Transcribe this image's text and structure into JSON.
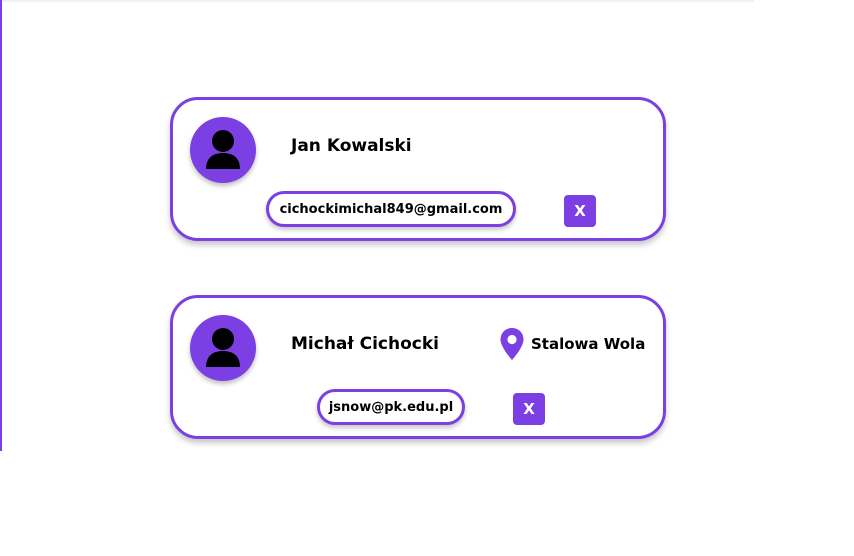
{
  "colors": {
    "accent": "#7b3fe4",
    "text": "#000000",
    "background": "#ffffff"
  },
  "contacts": [
    {
      "avatar_icon": "user-avatar-icon",
      "name": "Jan Kowalski",
      "email": "cichockimichal849@gmail.com",
      "delete_label": "X"
    },
    {
      "avatar_icon": "user-avatar-icon",
      "name": "Michał Cichocki",
      "location_icon": "map-pin-icon",
      "location": "Stalowa Wola",
      "email": "jsnow@pk.edu.pl",
      "delete_label": "X"
    }
  ]
}
